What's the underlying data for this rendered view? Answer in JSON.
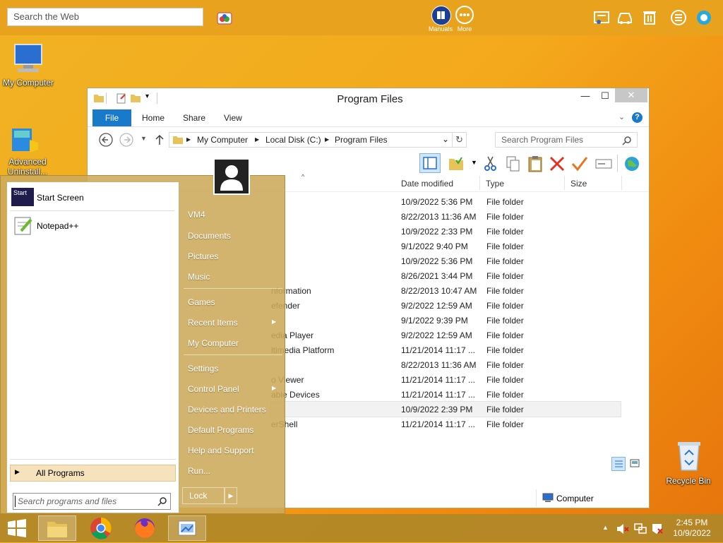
{
  "topbar": {
    "search_placeholder": "Search the Web",
    "manuals_label": "Manuals",
    "more_label": "More"
  },
  "desktop": {
    "my_computer": "My Computer",
    "advanced_uninstall_1": "Advanced",
    "advanced_uninstall_2": "Uninstall...",
    "recycle_bin": "Recycle Bin"
  },
  "explorer": {
    "title": "Program Files",
    "tabs": [
      "File",
      "Home",
      "Share",
      "View"
    ],
    "breadcrumb": [
      "My Computer",
      "Local Disk (C:)",
      "Program Files"
    ],
    "search_placeholder": "Search Program Files",
    "columns": {
      "date": "Date modified",
      "type": "Type",
      "size": "Size"
    },
    "rows": [
      {
        "name": "",
        "date": "10/9/2022 5:36 PM",
        "type": "File folder"
      },
      {
        "name": "",
        "date": "8/22/2013 11:36 AM",
        "type": "File folder"
      },
      {
        "name": "",
        "date": "10/9/2022 2:33 PM",
        "type": "File folder"
      },
      {
        "name": "",
        "date": "9/1/2022 9:40 PM",
        "type": "File folder"
      },
      {
        "name": "",
        "date": "10/9/2022 5:36 PM",
        "type": "File folder"
      },
      {
        "name": "",
        "date": "8/26/2021 3:44 PM",
        "type": "File folder"
      },
      {
        "name": "nformation",
        "date": "8/22/2013 10:47 AM",
        "type": "File folder"
      },
      {
        "name": "efender",
        "date": "9/2/2022 12:59 AM",
        "type": "File folder"
      },
      {
        "name": "",
        "date": "9/1/2022 9:39 PM",
        "type": "File folder"
      },
      {
        "name": "edia Player",
        "date": "9/2/2022 12:59 AM",
        "type": "File folder"
      },
      {
        "name": "ltimedia Platform",
        "date": "11/21/2014 11:17 ...",
        "type": "File folder"
      },
      {
        "name": "",
        "date": "8/22/2013 11:36 AM",
        "type": "File folder"
      },
      {
        "name": "o Viewer",
        "date": "11/21/2014 11:17 ...",
        "type": "File folder"
      },
      {
        "name": "able Devices",
        "date": "11/21/2014 11:17 ...",
        "type": "File folder"
      },
      {
        "name": "",
        "date": "10/9/2022 2:39 PM",
        "type": "File folder"
      },
      {
        "name": "erShell",
        "date": "11/21/2014 11:17 ...",
        "type": "File folder"
      }
    ],
    "status_location": "Computer"
  },
  "start_menu": {
    "pinned": [
      "Start Screen",
      "Notepad++"
    ],
    "start_icon_text": "Start",
    "all_programs": "All Programs",
    "search_placeholder": "Search programs and files",
    "right_items": {
      "user": "VM4",
      "documents": "Documents",
      "pictures": "Pictures",
      "music": "Music",
      "games": "Games",
      "recent": "Recent Items",
      "computer": "My Computer",
      "settings": "Settings",
      "control_panel": "Control Panel",
      "devices": "Devices and Printers",
      "default_programs": "Default Programs",
      "help": "Help and Support",
      "run": "Run..."
    },
    "lock": "Lock"
  },
  "taskbar": {
    "time": "2:45 PM",
    "date": "10/9/2022"
  },
  "colors": {
    "accent": "#1979ca",
    "wallpaper": "#f4a91c"
  }
}
